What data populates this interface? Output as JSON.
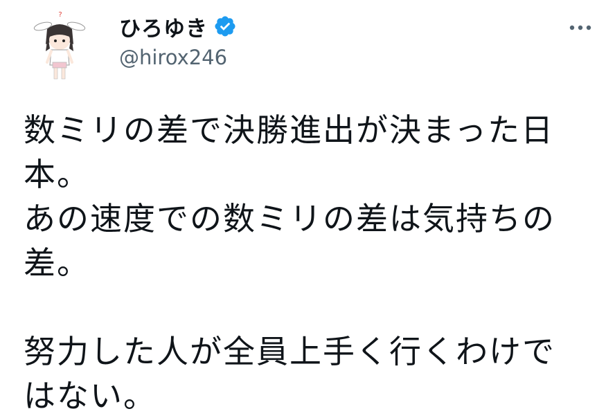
{
  "author": {
    "display_name": "ひろゆき",
    "handle": "@hirox246",
    "verified": true,
    "avatar_icon": "avatar-illustration"
  },
  "actions": {
    "more_icon": "more-horizontal-icon"
  },
  "tweet": {
    "lines": [
      "数ミリの差で決勝進出が決まった日",
      "本。",
      "あの速度での数ミリの差は気持ちの",
      "差。",
      "",
      "努力した人が全員上手く行くわけで",
      "はない。"
    ]
  },
  "colors": {
    "text": "#0f1419",
    "secondary_text": "#536471",
    "verified_badge": "#1d9bf0",
    "background": "#ffffff"
  }
}
